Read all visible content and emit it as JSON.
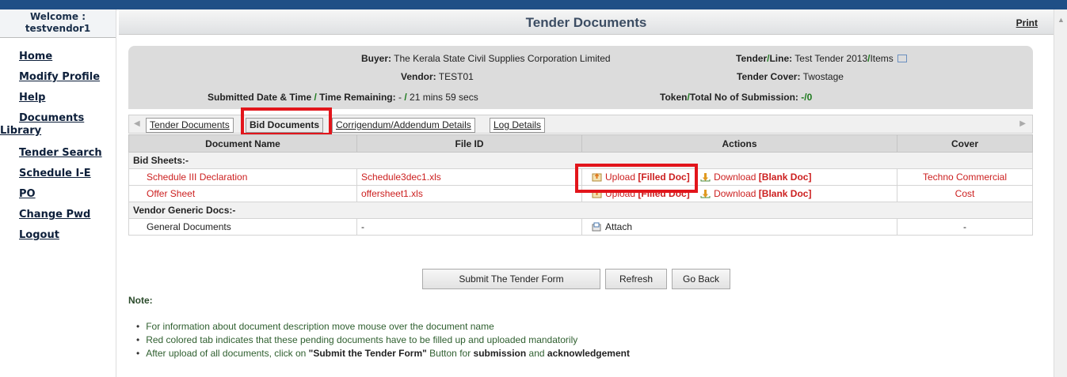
{
  "sidebar": {
    "welcome_line1": "Welcome :",
    "welcome_line2": "testvendor1",
    "items": [
      {
        "label": "Home"
      },
      {
        "label": "Modify Profile"
      },
      {
        "label": "Help"
      },
      {
        "label": "Documents"
      },
      {
        "label": "Library"
      },
      {
        "label": "Tender Search"
      },
      {
        "label": "Schedule I-E"
      },
      {
        "label": "PO"
      },
      {
        "label": "Change Pwd"
      },
      {
        "label": "Logout"
      }
    ]
  },
  "header": {
    "title": "Tender Documents",
    "print": "Print"
  },
  "info": {
    "buyer_label": "Buyer:",
    "buyer_value": "The Kerala State Civil Supplies Corporation Limited",
    "vendor_label": "Vendor:",
    "vendor_value": "TEST01",
    "submitted_label_a": "Submitted Date & Time",
    "submitted_label_b": "Time Remaining:",
    "submitted_value_a": "-",
    "submitted_value_b": "21 mins 59 secs",
    "tender_label_a": "Tender",
    "tender_label_b": "Line:",
    "tender_value_a": "Test Tender 2013",
    "tender_value_b": "Items",
    "cover_label": "Tender Cover:",
    "cover_value": "Twostage",
    "token_label_a": "Token",
    "token_label_b": "Total No of Submission:",
    "token_value_a": "-",
    "token_value_b": "0",
    "slash": "/"
  },
  "tabs": [
    {
      "label": "Tender Documents"
    },
    {
      "label": "Bid Documents"
    },
    {
      "label": "Corrigendum/Addendum Details"
    },
    {
      "label": "Log Details"
    }
  ],
  "table": {
    "headers": [
      "Document Name",
      "File ID",
      "Actions",
      "Cover"
    ],
    "section1": "Bid Sheets:-",
    "section2": "Vendor Generic Docs:-",
    "rows": [
      {
        "name": "Schedule III Declaration",
        "file": "Schedule3dec1.xls",
        "upload": "Upload",
        "upload_tag": "[Filled Doc]",
        "download": "Download",
        "download_tag": "[Blank Doc]",
        "cover": "Techno Commercial"
      },
      {
        "name": "Offer Sheet",
        "file": "offersheet1.xls",
        "upload": "Upload",
        "upload_tag": "[Filled Doc]",
        "download": "Download",
        "download_tag": "[Blank Doc]",
        "cover": "Cost"
      }
    ],
    "generic_row": {
      "name": "General Documents",
      "file": "-",
      "action": "Attach",
      "cover": "-"
    }
  },
  "buttons": {
    "submit": "Submit The Tender Form",
    "refresh": "Refresh",
    "goback": "Go Back"
  },
  "notes": {
    "title": "Note:",
    "line1": "For information about document description move mouse over the document name",
    "line2": "Red colored tab indicates that these pending documents have to be filled up and uploaded mandatorily",
    "line3_a": "After upload of all documents, click on ",
    "line3_b": "\"Submit the Tender Form\"",
    "line3_c": " Button for ",
    "line3_d": "submission",
    "line3_e": " and ",
    "line3_f": "acknowledgement"
  },
  "colors": {
    "highlight": "#e2151b",
    "link_red": "#cc1f1f",
    "separator_green": "#1e7a1e"
  }
}
